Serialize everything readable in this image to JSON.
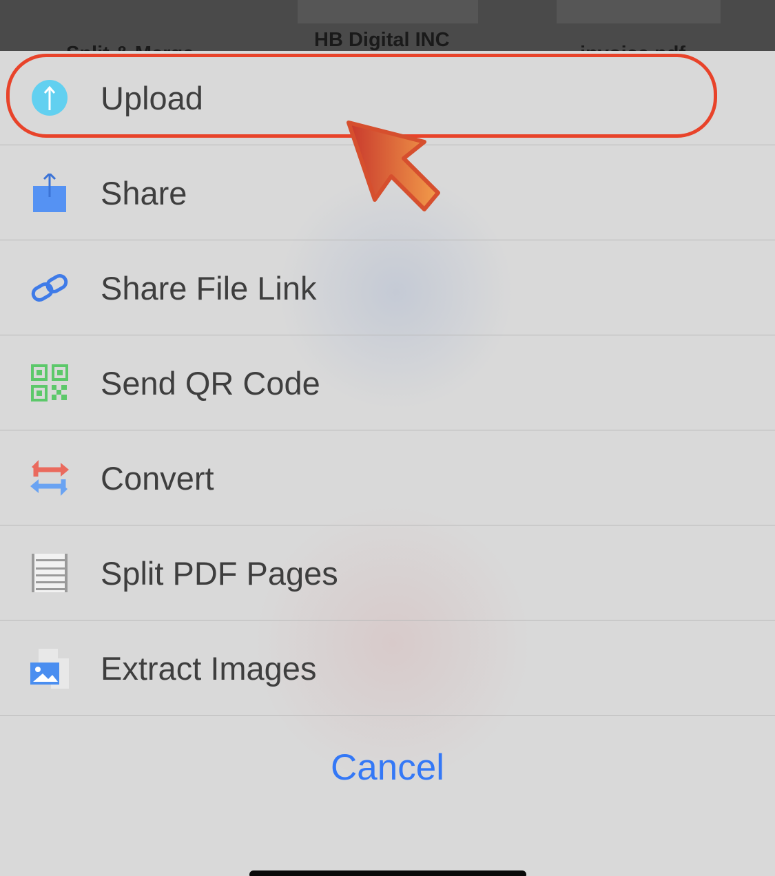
{
  "background": {
    "labels": [
      "Split & Merge",
      "HB Digital INC",
      "invoice.pdf"
    ]
  },
  "menu": {
    "items": [
      {
        "label": "Upload",
        "icon": "upload-icon"
      },
      {
        "label": "Share",
        "icon": "share-icon"
      },
      {
        "label": "Share File Link",
        "icon": "link-icon"
      },
      {
        "label": "Send QR Code",
        "icon": "qr-code-icon"
      },
      {
        "label": "Convert",
        "icon": "convert-icon"
      },
      {
        "label": "Split PDF Pages",
        "icon": "split-pages-icon"
      },
      {
        "label": "Extract Images",
        "icon": "image-icon"
      }
    ],
    "cancel_label": "Cancel"
  },
  "colors": {
    "highlight": "#e8432a",
    "accent": "#3478f6"
  }
}
